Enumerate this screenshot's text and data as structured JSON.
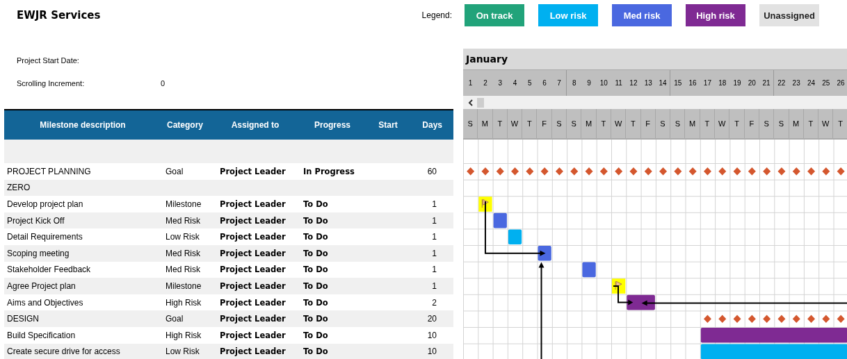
{
  "title": "EWJR Services",
  "legend": {
    "label": "Legend:",
    "items": [
      {
        "label": "On track",
        "color": "#21a37a"
      },
      {
        "label": "Low risk",
        "color": "#00b0f0"
      },
      {
        "label": "Med risk",
        "color": "#4a68e0"
      },
      {
        "label": "High risk",
        "color": "#7f2a93"
      },
      {
        "label": "Unassigned",
        "color": "#e2e2e2"
      }
    ]
  },
  "settings": [
    {
      "label": "Project Start Date:"
    },
    {
      "label": "Scrolling Increment:",
      "value": "0"
    }
  ],
  "table": {
    "columns": [
      "Milestone description",
      "Category",
      "Assigned to",
      "Progress",
      "Start",
      "Days"
    ],
    "rows": [
      {
        "description": "PROJECT PLANNING",
        "category": "Goal",
        "kind": "goal",
        "assigned_to": "Project Leader",
        "progress": "In Progress",
        "days": "60"
      },
      {
        "description": "ZERO",
        "kind": "none"
      },
      {
        "description": "Develop project plan",
        "category": "Milestone",
        "kind": "milestone",
        "assigned_to": "Project Leader",
        "progress": "To Do",
        "days": "1"
      },
      {
        "description": "Project Kick Off",
        "category": "Med Risk",
        "kind": "med",
        "assigned_to": "Project Leader",
        "progress": "To Do",
        "days": "1"
      },
      {
        "description": "Detail Requirements",
        "category": "Low Risk",
        "kind": "low",
        "assigned_to": "Project Leader",
        "progress": "To Do",
        "days": "1"
      },
      {
        "description": "Scoping meeting",
        "category": "Med Risk",
        "kind": "med",
        "assigned_to": "Project Leader",
        "progress": "To Do",
        "days": "1"
      },
      {
        "description": "Stakeholder Feedback",
        "category": "Med Risk",
        "kind": "med",
        "assigned_to": "Project Leader",
        "progress": "To Do",
        "days": "1"
      },
      {
        "description": "Agree Project plan",
        "category": "Milestone",
        "kind": "milestone",
        "assigned_to": "Project Leader",
        "progress": "To Do",
        "days": "1"
      },
      {
        "description": "Aims and Objectives",
        "category": "High Risk",
        "kind": "high",
        "assigned_to": "Project Leader",
        "progress": "To Do",
        "days": "2"
      },
      {
        "description": "DESIGN",
        "category": "Goal",
        "kind": "goal",
        "assigned_to": "Project Leader",
        "progress": "To Do",
        "days": "20"
      },
      {
        "description": "Build Specification",
        "category": "High Risk",
        "kind": "high",
        "assigned_to": "Project Leader",
        "progress": "To Do",
        "days": "10"
      },
      {
        "description": "Create secure drive for access",
        "category": "Low Risk",
        "kind": "low",
        "assigned_to": "Project Leader",
        "progress": "To Do",
        "days": "10"
      }
    ]
  },
  "timeline": {
    "month": "January",
    "days": [
      "1",
      "2",
      "3",
      "4",
      "5",
      "6",
      "7",
      "8",
      "9",
      "10",
      "11",
      "12",
      "13",
      "14",
      "15",
      "16",
      "17",
      "18",
      "19",
      "20",
      "21",
      "22",
      "23",
      "24",
      "25",
      "26"
    ],
    "weekdays": [
      "S",
      "M",
      "T",
      "W",
      "T",
      "F",
      "S",
      "S",
      "M",
      "T",
      "W",
      "T",
      "F",
      "S",
      "S",
      "M",
      "T",
      "W",
      "T",
      "F",
      "S",
      "S",
      "M",
      "T",
      "W",
      "T"
    ]
  }
}
